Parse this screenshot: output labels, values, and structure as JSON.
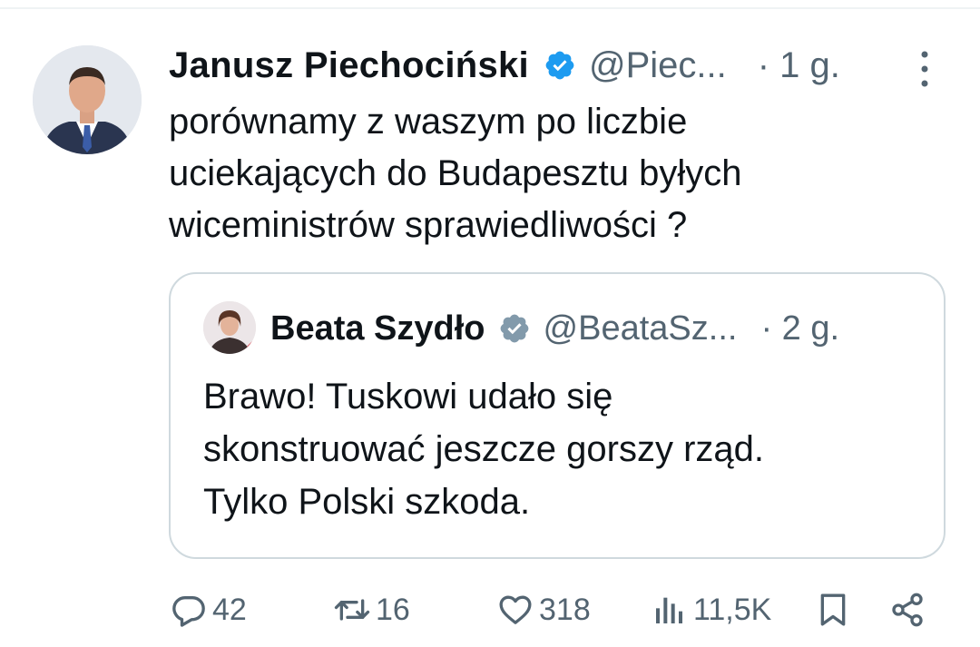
{
  "tweet": {
    "author": {
      "name": "Janusz Piechociński",
      "handle": "@Piec...",
      "time": "· 1 g.",
      "avatar_icon": "profile-photo-man",
      "verified_icon": "verified-badge-icon"
    },
    "text": "porównamy z waszym po liczbie\nuciekających do Budapesztu byłych\nwiceministrów  sprawiedliwości ?",
    "quoted": {
      "name": "Beata Szydło",
      "handle": "@BeataSz...",
      "time": "· 2 g.",
      "avatar_icon": "profile-photo-woman",
      "verified_icon": "gray-verified-badge-icon",
      "text": "Brawo! Tuskowi udało się\nskonstruować jeszcze gorszy rząd.\nTylko Polski szkoda."
    },
    "actions": {
      "replies": "42",
      "reposts": "16",
      "likes": "318",
      "views": "11,5K"
    }
  },
  "colors": {
    "verified_blue": "#1d9bf0",
    "verified_gray": "#829aab",
    "secondary_text": "#536471",
    "border": "#cfd9de"
  }
}
